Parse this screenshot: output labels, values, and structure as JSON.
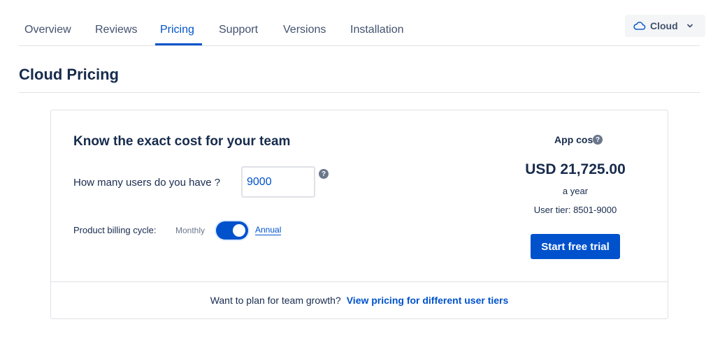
{
  "tabs": [
    {
      "label": "Overview"
    },
    {
      "label": "Reviews"
    },
    {
      "label": "Pricing",
      "active": true
    },
    {
      "label": "Support"
    },
    {
      "label": "Versions"
    },
    {
      "label": "Installation"
    }
  ],
  "deployment": {
    "label": "Cloud",
    "icon": "cloud-icon"
  },
  "page": {
    "title": "Cloud Pricing"
  },
  "calculator": {
    "heading": "Know the exact cost for your team",
    "users_label": "How many users do you have ?",
    "users_value": "9000",
    "help_glyph": "?",
    "billing_label": "Product billing cycle:",
    "monthly_label": "Monthly",
    "annual_label": "Annual",
    "billing_annual_selected": true
  },
  "cost": {
    "label": "App cost",
    "amount": "USD 21,725.00",
    "period": "a year",
    "tier": "User tier: 8501-9000",
    "cta": "Start free trial"
  },
  "footer": {
    "prompt": "Want to plan for team growth?",
    "link": "View pricing for different user tiers"
  },
  "colors": {
    "accent": "#0052cc",
    "text": "#172b4d",
    "muted": "#6b778c",
    "border": "#dfe1e6"
  }
}
